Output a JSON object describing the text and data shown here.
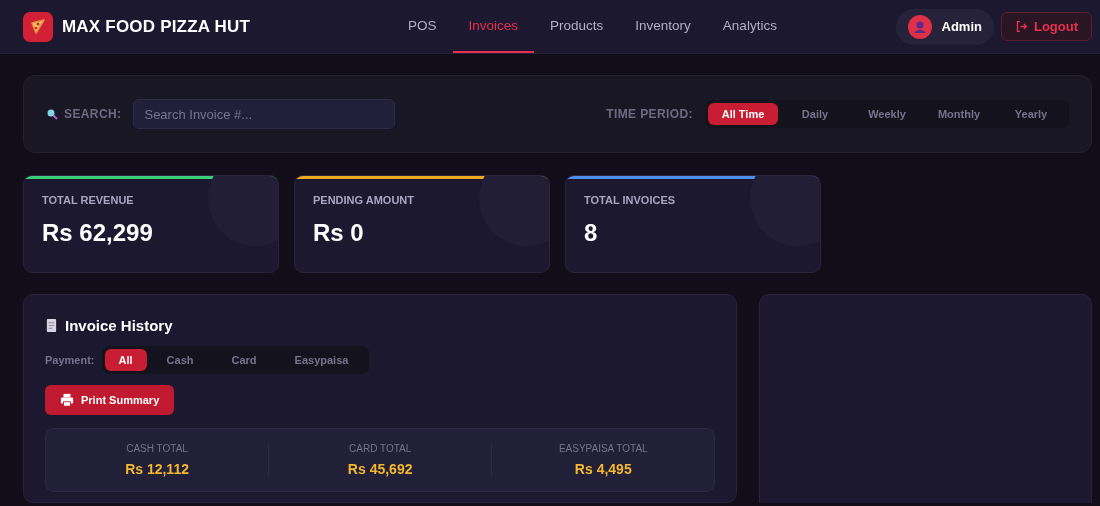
{
  "brand": {
    "title": "MAX FOOD PIZZA HUT"
  },
  "nav": [
    {
      "label": "POS",
      "selected": false
    },
    {
      "label": "Invoices",
      "selected": true
    },
    {
      "label": "Products",
      "selected": false
    },
    {
      "label": "Inventory",
      "selected": false
    },
    {
      "label": "Analytics",
      "selected": false
    }
  ],
  "user": {
    "name": "Admin"
  },
  "logout": {
    "label": "Logout"
  },
  "filters": {
    "search_label": "SEARCH:",
    "search": {
      "placeholder": "Search Invoice #..."
    },
    "period_label": "TIME PERIOD:",
    "periods": [
      {
        "label": "All Time",
        "selected": true
      },
      {
        "label": "Daily",
        "selected": false
      },
      {
        "label": "Weekly",
        "selected": false
      },
      {
        "label": "Monthly",
        "selected": false
      },
      {
        "label": "Yearly",
        "selected": false
      }
    ]
  },
  "stats": [
    {
      "label": "TOTAL REVENUE",
      "value": "Rs 62,299",
      "color": "#3ccf7a"
    },
    {
      "label": "PENDING AMOUNT",
      "value": "Rs 0",
      "color": "#f0a81e"
    },
    {
      "label": "TOTAL INVOICES",
      "value": "8",
      "color": "#4d8ef0"
    }
  ],
  "history": {
    "title": "Invoice History",
    "payment_label": "Payment:",
    "payments": [
      {
        "label": "All",
        "selected": true
      },
      {
        "label": "Cash",
        "selected": false
      },
      {
        "label": "Card",
        "selected": false
      },
      {
        "label": "Easypaisa",
        "selected": false
      }
    ],
    "print_button": "Print Summary",
    "totals": [
      {
        "label": "CASH TOTAL",
        "value": "Rs 12,112"
      },
      {
        "label": "CARD TOTAL",
        "value": "Rs 45,692"
      },
      {
        "label": "EASYPAISA TOTAL",
        "value": "Rs 4,495"
      }
    ]
  }
}
